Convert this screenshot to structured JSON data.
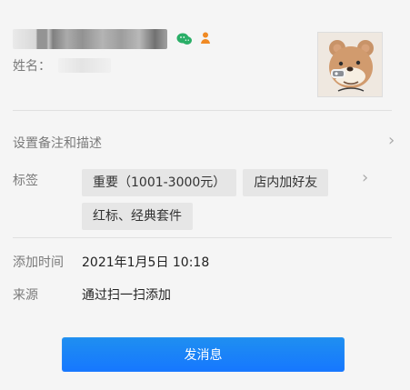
{
  "profile": {
    "real_name_label": "姓名："
  },
  "links": {
    "remark_description": "设置备注和描述"
  },
  "tags": {
    "label": "标签",
    "items": [
      "重要（1001-3000元）",
      "店内加好友",
      "红标、经典套件"
    ]
  },
  "info": {
    "add_time_label": "添加时间",
    "add_time_value": "2021年1月5日 10:18",
    "source_label": "来源",
    "source_value": "通过扫一扫添加"
  },
  "actions": {
    "send_message": "发消息"
  },
  "colors": {
    "background": "#f5f5f5",
    "text_primary": "#222222",
    "text_secondary": "#7a7a7a",
    "divider": "#e0e0e0",
    "tag_background": "#e6e6e6",
    "primary_button": "#1677ff",
    "wechat_green": "#2aae67",
    "person_orange": "#f08a24"
  },
  "icons": {
    "platform_icon": "wechat-icon",
    "contact_type_icon": "person-icon",
    "avatar_icon": "bear-eating-avatar",
    "chevron_icon": "chevron-right-icon"
  }
}
